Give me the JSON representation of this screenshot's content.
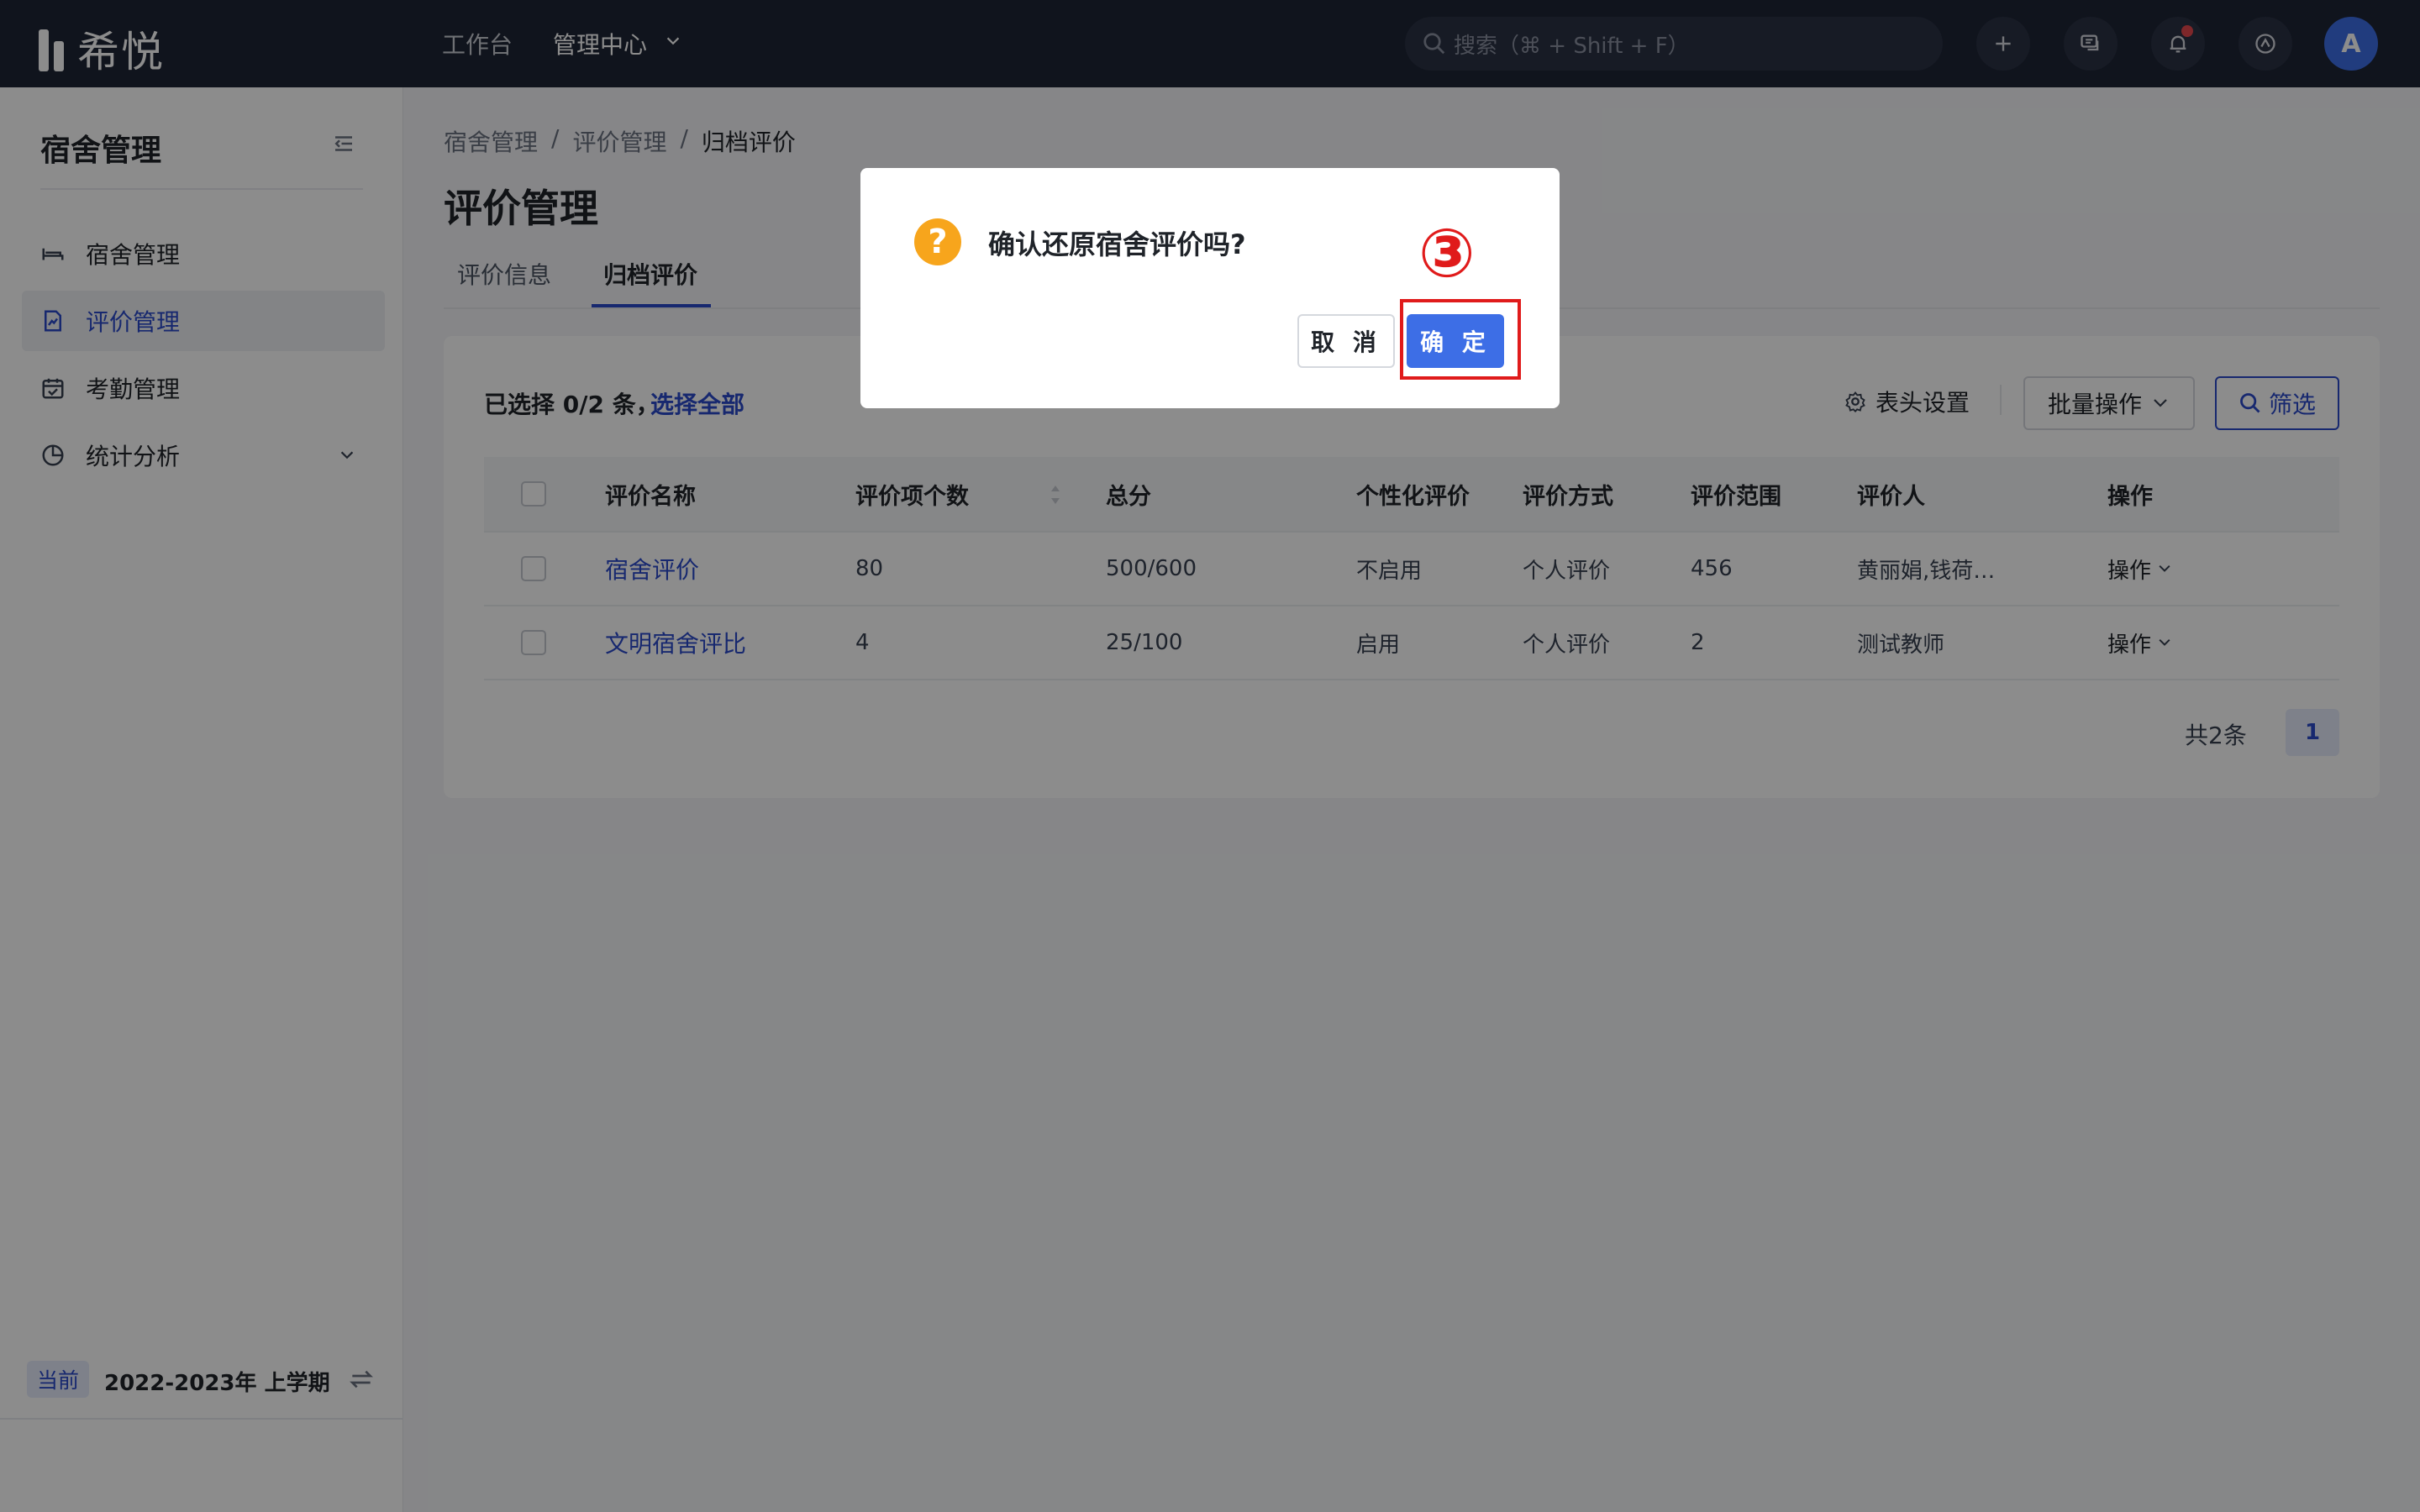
{
  "app": {
    "logo_text": "希悦"
  },
  "topnav": {
    "workbench": "工作台",
    "management": "管理中心"
  },
  "search": {
    "placeholder": "搜索（⌘ + Shift + F）"
  },
  "user": {
    "avatar_letter": "A"
  },
  "sidebar": {
    "title": "宿舍管理",
    "items": [
      {
        "label": "宿舍管理",
        "icon": "bed-icon",
        "active": false
      },
      {
        "label": "评价管理",
        "icon": "evaluation-doc-icon",
        "active": true
      },
      {
        "label": "考勤管理",
        "icon": "calendar-check-icon",
        "active": false
      },
      {
        "label": "统计分析",
        "icon": "pie-chart-icon",
        "active": false,
        "expandable": true
      }
    ],
    "term_badge": "当前",
    "term_label": "2022-2023年 上学期"
  },
  "breadcrumb": [
    "宿舍管理",
    "评价管理",
    "归档评价"
  ],
  "page": {
    "title": "评价管理",
    "tabs": [
      {
        "label": "评价信息",
        "active": false
      },
      {
        "label": "归档评价",
        "active": true
      }
    ]
  },
  "toolbar": {
    "selection": "已选择 0/2 条，",
    "select_all": "选择全部",
    "column_settings": "表头设置",
    "batch": "批量操作",
    "filter": "筛选"
  },
  "table": {
    "headers": [
      "评价名称",
      "评价项个数",
      "总分",
      "个性化评价",
      "评价方式",
      "评价范围",
      "评价人",
      "操作"
    ],
    "rows": [
      {
        "name": "宿舍评价",
        "items": "80",
        "score": "500/600",
        "personalized": "不启用",
        "method": "个人评价",
        "range": "456",
        "evaluator": "黄丽娟,钱荷…",
        "action": "操作"
      },
      {
        "name": "文明宿舍评比",
        "items": "4",
        "score": "25/100",
        "personalized": "启用",
        "method": "个人评价",
        "range": "2",
        "evaluator": "测试教师",
        "action": "操作"
      }
    ]
  },
  "pagination": {
    "total": "共2条",
    "current": "1"
  },
  "modal": {
    "title": "确认还原宿舍评价吗?",
    "cancel": "取 消",
    "confirm": "确 定",
    "step_marker": "③"
  },
  "colors": {
    "accent": "#2b4acb",
    "primary_button": "#3d6ee6",
    "warning": "#f7a51c",
    "annotation": "#e01b1b",
    "topbar": "#1e2535"
  }
}
